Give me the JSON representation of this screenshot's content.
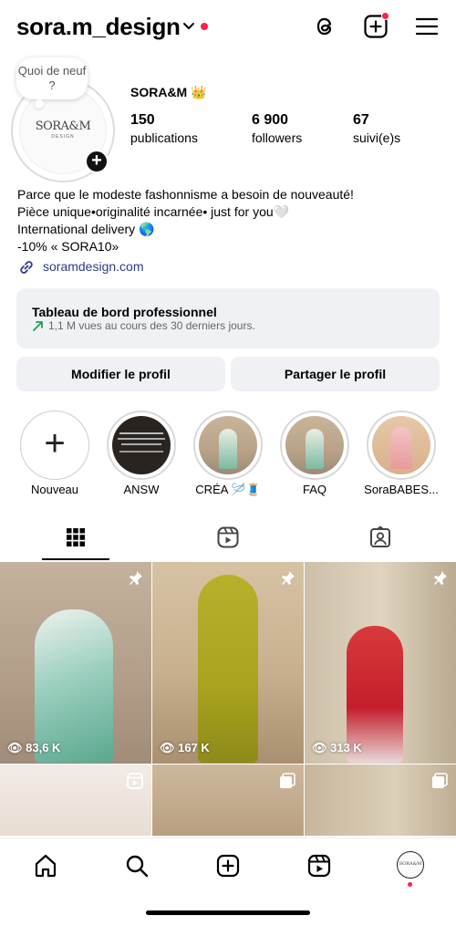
{
  "header": {
    "username": "sora.m_design"
  },
  "profile": {
    "note": "Quoi de neuf ?",
    "logo_text": "SORA&M",
    "logo_sub": "DESIGN",
    "display_name": "SORA&M 👑",
    "stats": [
      {
        "value": "150",
        "label": "publications"
      },
      {
        "value": "6 900",
        "label": "followers"
      },
      {
        "value": "67",
        "label": "suivi(e)s"
      }
    ],
    "bio": [
      "Parce que le modeste fashonnisme a besoin de nouveauté!",
      "Pièce unique•originalité incarnée• just for you🤍",
      "International delivery 🌎",
      "-10% « SORA10»"
    ],
    "link": "soramdesign.com"
  },
  "dashboard": {
    "title": "Tableau de bord professionnel",
    "subtitle": "1,1 M vues au cours des 30 derniers jours."
  },
  "buttons": {
    "edit": "Modifier le profil",
    "share": "Partager le profil"
  },
  "highlights": [
    {
      "label": "Nouveau"
    },
    {
      "label": "ANSW"
    },
    {
      "label": "CRÉA 🪡🧵"
    },
    {
      "label": "FAQ"
    },
    {
      "label": "SoraBABES..."
    }
  ],
  "tabs": [
    "grid",
    "reels",
    "tagged"
  ],
  "posts": [
    {
      "views": "83,6 K",
      "pinned": true
    },
    {
      "views": "167 K",
      "pinned": true
    },
    {
      "views": "313 K",
      "pinned": true
    },
    {
      "views": "",
      "type": "reel"
    },
    {
      "views": "",
      "type": "carousel"
    },
    {
      "views": "",
      "type": "carousel"
    }
  ],
  "colors": {
    "accent_red": "#ff1f4b",
    "link_blue": "#2d3a8c",
    "button_bg": "#eff1f4",
    "trend_green": "#1f9d55"
  }
}
